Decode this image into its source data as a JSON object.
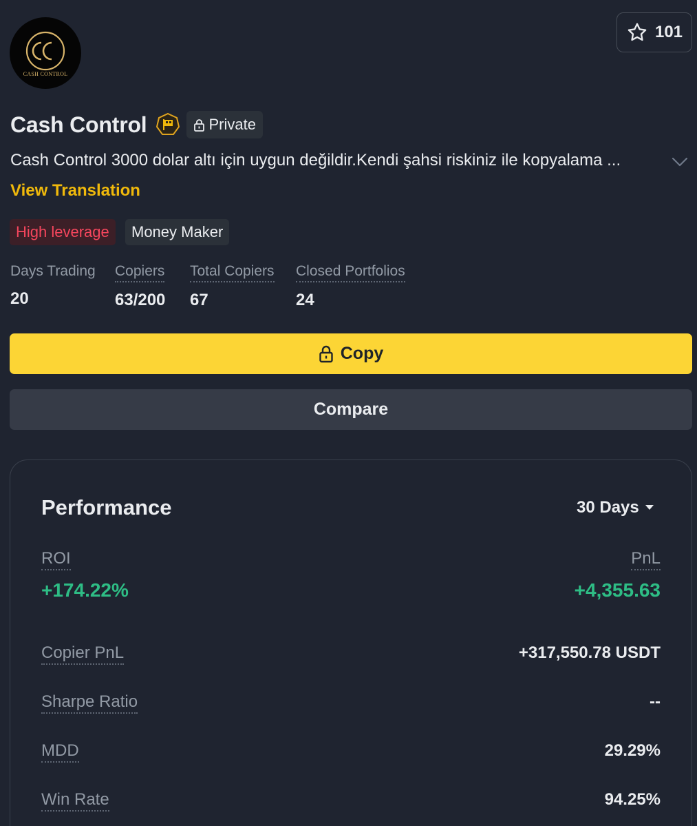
{
  "profile": {
    "avatar_text": "CASH CONTROL",
    "name": "Cash Control",
    "private_label": "Private",
    "description": "Cash Control 3000 dolar altı için uygun değildir.Kendi şahsi riskiniz ile kopyalama ...",
    "view_translation": "View Translation",
    "favorites_count": "101"
  },
  "tags": [
    "High leverage",
    "Money Maker"
  ],
  "stats": [
    {
      "label": "Days Trading",
      "value": "20"
    },
    {
      "label": "Copiers",
      "value": "63/200"
    },
    {
      "label": "Total Copiers",
      "value": "67"
    },
    {
      "label": "Closed Portfolios",
      "value": "24"
    }
  ],
  "actions": {
    "copy": "Copy",
    "compare": "Compare"
  },
  "performance": {
    "title": "Performance",
    "period": "30 Days",
    "roi_label": "ROI",
    "roi_value": "+174.22%",
    "pnl_label": "PnL",
    "pnl_value": "+4,355.63",
    "rows": [
      {
        "label": "Copier PnL",
        "value": "+317,550.78 USDT"
      },
      {
        "label": "Sharpe Ratio",
        "value": "--"
      },
      {
        "label": "MDD",
        "value": "29.29%"
      },
      {
        "label": "Win Rate",
        "value": "94.25%"
      }
    ]
  },
  "colors": {
    "background": "#1f2430",
    "accent_yellow": "#fcd535",
    "positive_green": "#2ebd85",
    "risk_red": "#f6465d"
  },
  "icons": {
    "favorite": "star-icon",
    "lock": "lock-icon",
    "badge": "verified-badge-icon",
    "expand": "chevron-down-icon",
    "dropdown": "caret-down-icon"
  }
}
